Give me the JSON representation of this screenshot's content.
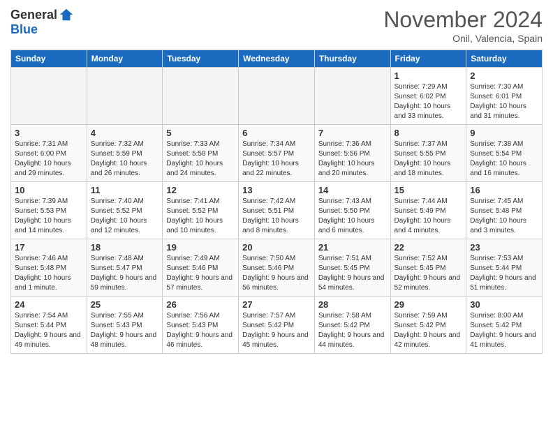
{
  "header": {
    "logo_general": "General",
    "logo_blue": "Blue",
    "month_title": "November 2024",
    "location": "Onil, Valencia, Spain"
  },
  "weekdays": [
    "Sunday",
    "Monday",
    "Tuesday",
    "Wednesday",
    "Thursday",
    "Friday",
    "Saturday"
  ],
  "weeks": [
    [
      {
        "day": "",
        "empty": true
      },
      {
        "day": "",
        "empty": true
      },
      {
        "day": "",
        "empty": true
      },
      {
        "day": "",
        "empty": true
      },
      {
        "day": "",
        "empty": true
      },
      {
        "day": "1",
        "sunrise": "7:29 AM",
        "sunset": "6:02 PM",
        "daylight": "10 hours and 33 minutes."
      },
      {
        "day": "2",
        "sunrise": "7:30 AM",
        "sunset": "6:01 PM",
        "daylight": "10 hours and 31 minutes."
      }
    ],
    [
      {
        "day": "3",
        "sunrise": "7:31 AM",
        "sunset": "6:00 PM",
        "daylight": "10 hours and 29 minutes."
      },
      {
        "day": "4",
        "sunrise": "7:32 AM",
        "sunset": "5:59 PM",
        "daylight": "10 hours and 26 minutes."
      },
      {
        "day": "5",
        "sunrise": "7:33 AM",
        "sunset": "5:58 PM",
        "daylight": "10 hours and 24 minutes."
      },
      {
        "day": "6",
        "sunrise": "7:34 AM",
        "sunset": "5:57 PM",
        "daylight": "10 hours and 22 minutes."
      },
      {
        "day": "7",
        "sunrise": "7:36 AM",
        "sunset": "5:56 PM",
        "daylight": "10 hours and 20 minutes."
      },
      {
        "day": "8",
        "sunrise": "7:37 AM",
        "sunset": "5:55 PM",
        "daylight": "10 hours and 18 minutes."
      },
      {
        "day": "9",
        "sunrise": "7:38 AM",
        "sunset": "5:54 PM",
        "daylight": "10 hours and 16 minutes."
      }
    ],
    [
      {
        "day": "10",
        "sunrise": "7:39 AM",
        "sunset": "5:53 PM",
        "daylight": "10 hours and 14 minutes."
      },
      {
        "day": "11",
        "sunrise": "7:40 AM",
        "sunset": "5:52 PM",
        "daylight": "10 hours and 12 minutes."
      },
      {
        "day": "12",
        "sunrise": "7:41 AM",
        "sunset": "5:52 PM",
        "daylight": "10 hours and 10 minutes."
      },
      {
        "day": "13",
        "sunrise": "7:42 AM",
        "sunset": "5:51 PM",
        "daylight": "10 hours and 8 minutes."
      },
      {
        "day": "14",
        "sunrise": "7:43 AM",
        "sunset": "5:50 PM",
        "daylight": "10 hours and 6 minutes."
      },
      {
        "day": "15",
        "sunrise": "7:44 AM",
        "sunset": "5:49 PM",
        "daylight": "10 hours and 4 minutes."
      },
      {
        "day": "16",
        "sunrise": "7:45 AM",
        "sunset": "5:48 PM",
        "daylight": "10 hours and 3 minutes."
      }
    ],
    [
      {
        "day": "17",
        "sunrise": "7:46 AM",
        "sunset": "5:48 PM",
        "daylight": "10 hours and 1 minute."
      },
      {
        "day": "18",
        "sunrise": "7:48 AM",
        "sunset": "5:47 PM",
        "daylight": "9 hours and 59 minutes."
      },
      {
        "day": "19",
        "sunrise": "7:49 AM",
        "sunset": "5:46 PM",
        "daylight": "9 hours and 57 minutes."
      },
      {
        "day": "20",
        "sunrise": "7:50 AM",
        "sunset": "5:46 PM",
        "daylight": "9 hours and 56 minutes."
      },
      {
        "day": "21",
        "sunrise": "7:51 AM",
        "sunset": "5:45 PM",
        "daylight": "9 hours and 54 minutes."
      },
      {
        "day": "22",
        "sunrise": "7:52 AM",
        "sunset": "5:45 PM",
        "daylight": "9 hours and 52 minutes."
      },
      {
        "day": "23",
        "sunrise": "7:53 AM",
        "sunset": "5:44 PM",
        "daylight": "9 hours and 51 minutes."
      }
    ],
    [
      {
        "day": "24",
        "sunrise": "7:54 AM",
        "sunset": "5:44 PM",
        "daylight": "9 hours and 49 minutes."
      },
      {
        "day": "25",
        "sunrise": "7:55 AM",
        "sunset": "5:43 PM",
        "daylight": "9 hours and 48 minutes."
      },
      {
        "day": "26",
        "sunrise": "7:56 AM",
        "sunset": "5:43 PM",
        "daylight": "9 hours and 46 minutes."
      },
      {
        "day": "27",
        "sunrise": "7:57 AM",
        "sunset": "5:42 PM",
        "daylight": "9 hours and 45 minutes."
      },
      {
        "day": "28",
        "sunrise": "7:58 AM",
        "sunset": "5:42 PM",
        "daylight": "9 hours and 44 minutes."
      },
      {
        "day": "29",
        "sunrise": "7:59 AM",
        "sunset": "5:42 PM",
        "daylight": "9 hours and 42 minutes."
      },
      {
        "day": "30",
        "sunrise": "8:00 AM",
        "sunset": "5:42 PM",
        "daylight": "9 hours and 41 minutes."
      }
    ]
  ]
}
